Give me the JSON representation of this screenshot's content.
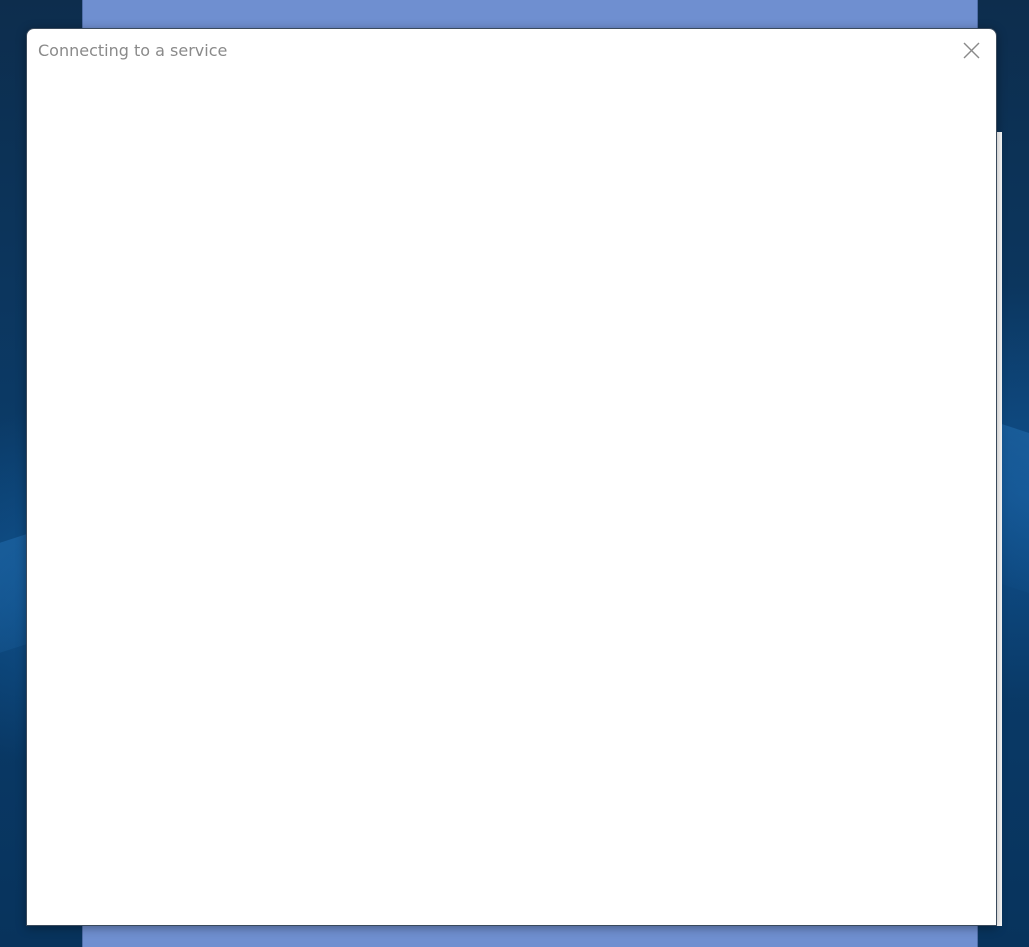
{
  "dialog": {
    "title": "Connecting to a service",
    "close_icon": "close-icon"
  },
  "colors": {
    "parent_window": "#6f8fd0",
    "dialog_background": "#ffffff",
    "title_text": "#8a8a8a",
    "desktop": "#0b3a66"
  }
}
